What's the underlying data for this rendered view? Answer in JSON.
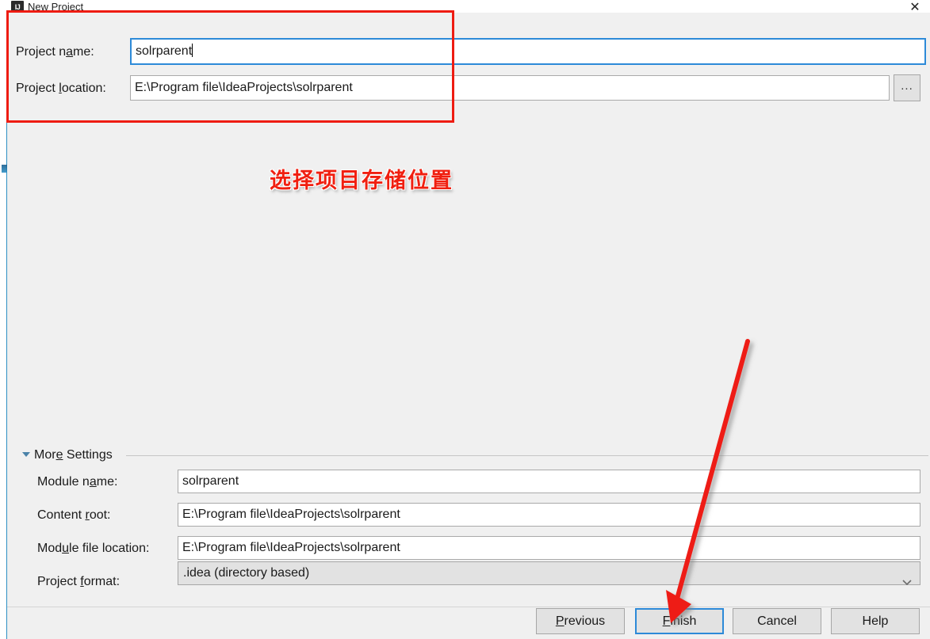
{
  "window": {
    "title": "New Project",
    "icon": "IJ",
    "close_icon": "✕"
  },
  "top_form": {
    "project_name": {
      "label_pre": "Project n",
      "label_mnemonic": "a",
      "label_post": "me:",
      "value": "solrparent"
    },
    "project_location": {
      "label_pre": "Project ",
      "label_mnemonic": "l",
      "label_post": "ocation:",
      "value": "E:\\Program file\\IdeaProjects\\solrparent"
    },
    "browse_button": "..."
  },
  "more_settings": {
    "label_pre": "Mor",
    "label_mnemonic": "e",
    "label_post": " Settings",
    "expanded": true,
    "fields": [
      {
        "label_pre": "Module n",
        "label_mnemonic": "a",
        "label_post": "me:",
        "value": "solrparent",
        "widget": "text"
      },
      {
        "label_pre": "Content ",
        "label_mnemonic": "r",
        "label_post": "oot:",
        "value": "E:\\Program file\\IdeaProjects\\solrparent",
        "widget": "text-folder"
      },
      {
        "label_pre": "Mod",
        "label_mnemonic": "u",
        "label_post": "le file location:",
        "value": "E:\\Program file\\IdeaProjects\\solrparent",
        "widget": "text-folder"
      },
      {
        "label_pre": "Project ",
        "label_mnemonic": "f",
        "label_post": "ormat:",
        "value": ".idea (directory based)",
        "widget": "combo"
      }
    ]
  },
  "buttons": {
    "previous": {
      "pre": "",
      "mnemonic": "P",
      "post": "revious"
    },
    "finish": {
      "pre": "",
      "mnemonic": "F",
      "post": "inish"
    },
    "cancel": {
      "pre": "Cancel",
      "mnemonic": "",
      "post": ""
    },
    "help": {
      "pre": "Help",
      "mnemonic": "",
      "post": ""
    }
  },
  "annotations": {
    "highlight_text": "选择项目存储位置",
    "rect_color": "#ee1c12",
    "arrow_color": "#ee1c12",
    "text_color": "#f01f10"
  }
}
